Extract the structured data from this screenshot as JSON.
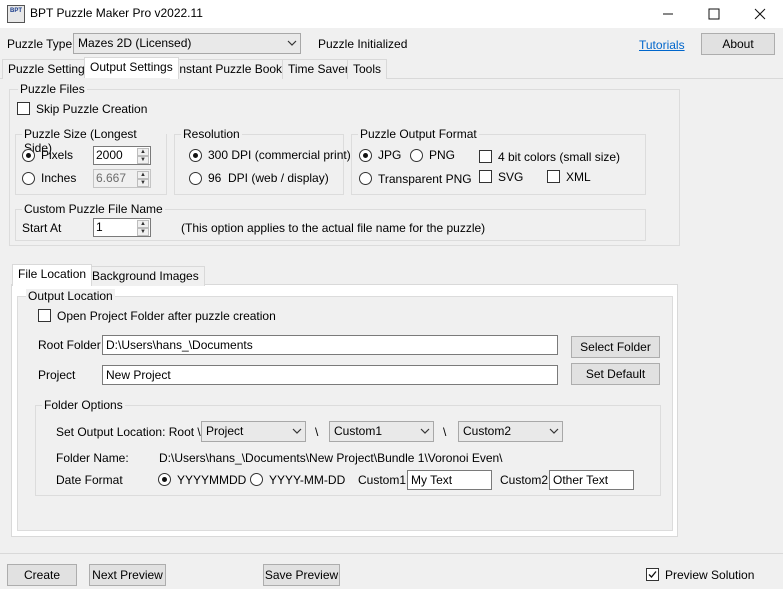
{
  "window": {
    "title": "BPT Puzzle Maker Pro v2022.11",
    "icon_text": "BPT"
  },
  "header": {
    "puzzle_type_label": "Puzzle Type",
    "puzzle_type_value": "Mazes 2D (Licensed)",
    "status": "Puzzle Initialized",
    "tutorials_link": "Tutorials",
    "about_button": "About"
  },
  "tabs": [
    "Puzzle Settings",
    "Output Settings",
    "Instant Puzzle Books",
    "Time Saver",
    "Tools"
  ],
  "puzzle_files": {
    "title": "Puzzle Files",
    "skip_label": "Skip Puzzle Creation",
    "size": {
      "title": "Puzzle Size (Longest Side)",
      "pixels_label": "Pixels",
      "pixels_value": "2000",
      "inches_label": "Inches",
      "inches_value": "6.667"
    },
    "resolution": {
      "title": "Resolution",
      "opt1": "300 DPI (commercial print)",
      "opt2": "96  DPI (web / display)"
    },
    "format": {
      "title": "Puzzle Output Format",
      "jpg": "JPG",
      "png": "PNG",
      "transparent_png": "Transparent PNG",
      "bit4": "4 bit colors (small size)",
      "svg": "SVG",
      "xml": "XML"
    },
    "custom_name": {
      "title": "Custom Puzzle File Name",
      "start_at_label": "Start At",
      "start_at_value": "1",
      "note": "(This option applies to the actual file name for the puzzle)"
    }
  },
  "inner_tabs": [
    "File Location",
    "Background Images"
  ],
  "output_location": {
    "title": "Output Location",
    "open_folder_label": "Open Project Folder after puzzle creation",
    "root_folder_label": "Root Folder",
    "root_folder_value": "D:\\Users\\hans_\\Documents",
    "select_folder_button": "Select Folder",
    "project_label": "Project",
    "project_value": "New Project",
    "set_default_button": "Set Default"
  },
  "folder_options": {
    "title": "Folder Options",
    "set_output_label": "Set Output Location: Root \\",
    "combo1": "Project",
    "combo2": "Custom1",
    "combo3": "Custom2",
    "sep": "\\",
    "folder_name_label": "Folder Name:",
    "folder_name_value": "D:\\Users\\hans_\\Documents\\New Project\\Bundle 1\\Voronoi Even\\",
    "date_format_label": "Date Format",
    "date_opt1": "YYYYMMDD",
    "date_opt2": "YYYY-MM-DD",
    "custom1_label": "Custom1:",
    "custom1_value": "My Text",
    "custom2_label": "Custom2:",
    "custom2_value": "Other Text"
  },
  "footer": {
    "create_button": "Create",
    "next_preview_button": "Next Preview",
    "save_preview_button": "Save Preview",
    "preview_solution_label": "Preview Solution"
  }
}
